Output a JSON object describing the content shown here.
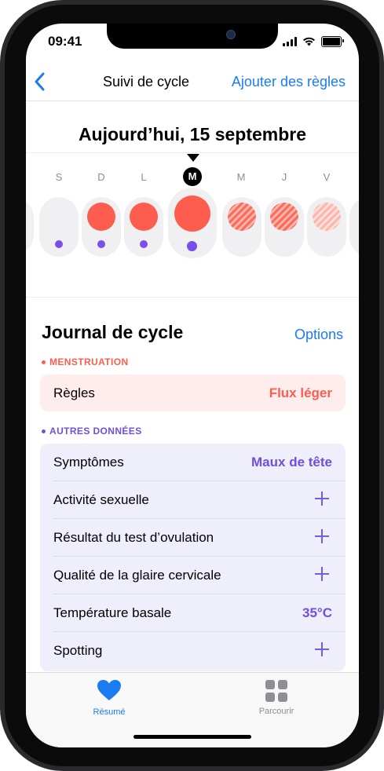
{
  "status_bar": {
    "time": "09:41"
  },
  "nav": {
    "back_label": "‹",
    "title": "Suivi de cycle",
    "action": "Ajouter des règles"
  },
  "calendar": {
    "date_title": "Aujourd’hui, 15 septembre",
    "days": [
      {
        "letter": "S",
        "today": false,
        "flow": "none",
        "logged": true
      },
      {
        "letter": "D",
        "today": false,
        "flow": "period",
        "logged": true
      },
      {
        "letter": "L",
        "today": false,
        "flow": "period",
        "logged": true
      },
      {
        "letter": "M",
        "today": true,
        "flow": "period",
        "logged": true
      },
      {
        "letter": "M",
        "today": false,
        "flow": "predicted",
        "logged": false
      },
      {
        "letter": "J",
        "today": false,
        "flow": "predicted",
        "logged": false
      },
      {
        "letter": "V",
        "today": false,
        "flow": "predicted-light",
        "logged": false
      }
    ]
  },
  "journal": {
    "title": "Journal de cycle",
    "options_label": "Options",
    "menstruation": {
      "category": "MENSTRUATION",
      "row": {
        "label": "Règles",
        "value": "Flux léger"
      }
    },
    "other": {
      "category": "AUTRES DONNÉES",
      "rows": [
        {
          "label": "Symptômes",
          "value": "Maux de tête"
        },
        {
          "label": "Activité sexuelle",
          "value": null
        },
        {
          "label": "Résultat du test d’ovulation",
          "value": null
        },
        {
          "label": "Qualité de la glaire cervicale",
          "value": null
        },
        {
          "label": "Température basale",
          "value": "35°C"
        },
        {
          "label": "Spotting",
          "value": null
        }
      ]
    }
  },
  "tabbar": {
    "tabs": [
      {
        "label": "Résumé",
        "icon": "heart-icon",
        "active": true
      },
      {
        "label": "Parcourir",
        "icon": "grid-icon",
        "active": false
      }
    ]
  },
  "colors": {
    "accent": "#1a7cf0",
    "period": "#fc5d4e",
    "other_data": "#6f4ee0",
    "menstruation_bg": "#ffeded",
    "other_bg": "#efeefb"
  }
}
